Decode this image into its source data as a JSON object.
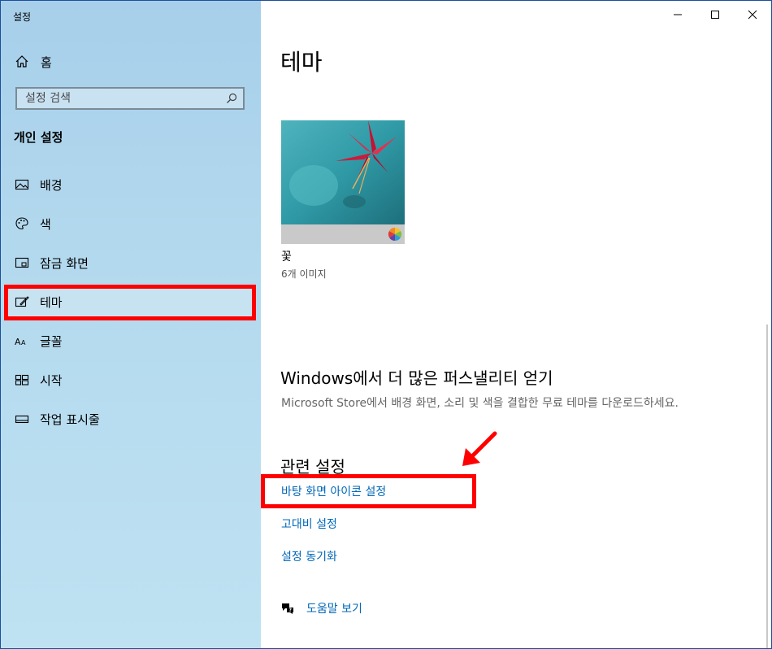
{
  "window": {
    "title": "설정"
  },
  "sidebar": {
    "home_label": "홈",
    "search_placeholder": "설정 검색",
    "section_title": "개인 설정",
    "items": [
      {
        "label": "배경",
        "icon": "image-icon"
      },
      {
        "label": "색",
        "icon": "palette-icon"
      },
      {
        "label": "잠금 화면",
        "icon": "lock-screen-icon"
      },
      {
        "label": "테마",
        "icon": "theme-icon",
        "selected": true
      },
      {
        "label": "글꼴",
        "icon": "font-icon"
      },
      {
        "label": "시작",
        "icon": "start-icon"
      },
      {
        "label": "작업 표시줄",
        "icon": "taskbar-icon"
      }
    ]
  },
  "main": {
    "page_title": "테마",
    "theme": {
      "name": "꽃",
      "count": "6개 이미지"
    },
    "get_more": {
      "heading": "Windows에서 더 많은 퍼스낼리티 얻기",
      "description": "Microsoft Store에서 배경 화면, 소리 및 색을 결합한 무료 테마를 다운로드하세요."
    },
    "related": {
      "heading": "관련 설정",
      "links": [
        "바탕 화면 아이콘 설정",
        "고대비 설정",
        "설정 동기화"
      ]
    },
    "help_label": "도움말 보기"
  },
  "colors": {
    "accent_link": "#0067b8",
    "highlight_red": "#ff0000",
    "sidebar_bg": "#b3d9ee"
  }
}
